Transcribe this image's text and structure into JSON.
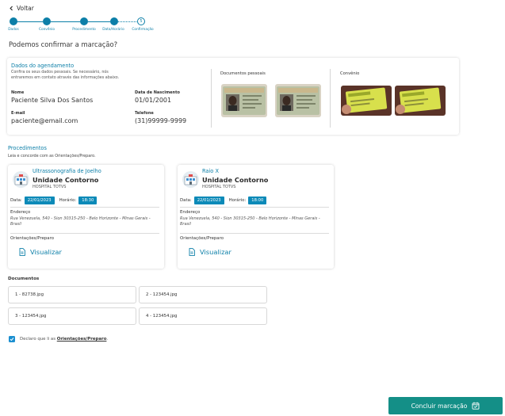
{
  "nav": {
    "back_label": "Voltar"
  },
  "stepper": {
    "steps": [
      "Dados",
      "Convênio",
      "Procedimento",
      "Data/Horário",
      "Confirmação"
    ],
    "current_step_number": "5"
  },
  "page": {
    "title": "Podemos confirmar a marcação?"
  },
  "summary": {
    "title": "Dados do agendamento",
    "subtitle_line1": "Confira os seus dados pessoais. Se necessário, nós",
    "subtitle_line2": "entraremos em contato através das informações abaixo.",
    "name_label": "Nome",
    "name_value": "Paciente Silva Dos Santos",
    "birth_label": "Data de Nascimento",
    "birth_value": "01/01/2001",
    "email_label": "E-mail",
    "email_value": "paciente@email.com",
    "phone_label": "Telefone",
    "phone_value": "(31)99999-9999",
    "personal_docs_title": "Documentos pessoais",
    "insurance_title": "Convênio"
  },
  "procedures": {
    "title": "Procedimentos",
    "subtitle": "Leia e concorde com as Orientações/Preparo.",
    "items": [
      {
        "name": "Ultrassonografia de Joelho",
        "unit": "Unidade Contorno",
        "hospital": "HOSPITAL TOTVS",
        "date_label": "Data:",
        "date": "22/01/2023",
        "time_label": "Horário:",
        "time": "18:30",
        "address_label": "Endereço",
        "address": "Rua Venezuela, 540 - Sion 30315-250 - Belo Horizonte - Minas Gerais - Brasil",
        "guidance_label": "Orientações/Preparo",
        "view_label": "Visualizar"
      },
      {
        "name": "Raio X",
        "unit": "Unidade Contorno",
        "hospital": "HOSPITAL TOTVS",
        "date_label": "Data:",
        "date": "22/01/2023",
        "time_label": "Horário:",
        "time": "18:00",
        "address_label": "Endereço",
        "address": "Rua Venezuela, 540 - Sion 30315-250 - Belo Horizonte - Minas Gerais - Brasil",
        "guidance_label": "Orientações/Preparo",
        "view_label": "Visualizar"
      }
    ]
  },
  "documents": {
    "title": "Documentos",
    "files": [
      "1 - 82738.jpg",
      "2 - 123454.jpg",
      "3 - 123454.jpg",
      "4 - 123454.jpg"
    ]
  },
  "declaration": {
    "prefix": "Declaro que li as ",
    "link": "Orientações/Preparo",
    "suffix": ".",
    "checked": true
  },
  "actions": {
    "submit_label": "Concluir marcação"
  },
  "colors": {
    "primary": "#0c7fa8",
    "date_chip": "#0c8ab8",
    "submit": "#148f87",
    "checkbox": "#1b8fd0"
  }
}
